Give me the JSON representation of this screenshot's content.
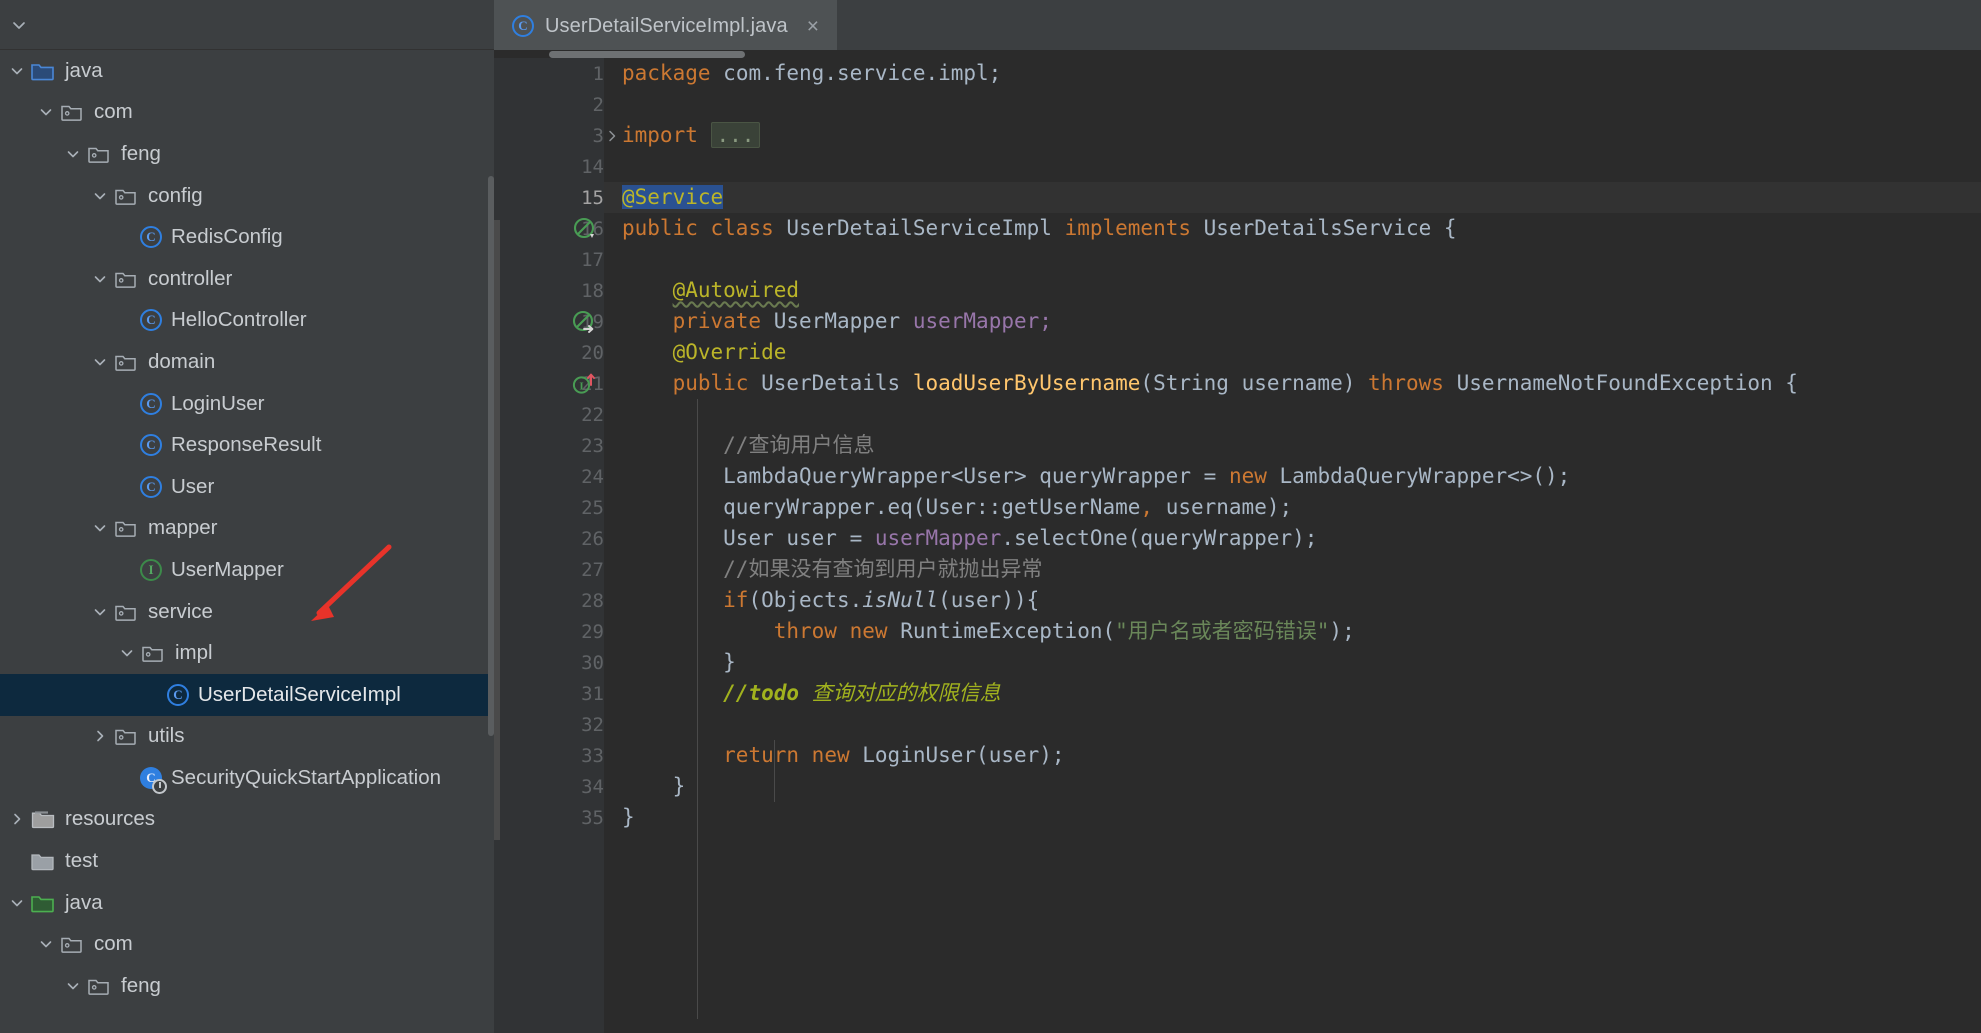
{
  "window": {
    "theme": "darcula",
    "accent_selection": "#2a5191",
    "tree_selection_bg": "#0d293e",
    "editor_bg": "#2b2b2b",
    "gutter_bg": "#313335",
    "panel_bg": "#3c3f41"
  },
  "tabs": {
    "active_index": 0,
    "items": [
      {
        "label": "UserDetailServiceImpl.java",
        "icon": "class-icon",
        "close_label": "×"
      }
    ]
  },
  "project_tree": {
    "collapse_all_icon": "chevron-down-icon",
    "nodes": [
      {
        "label": "java",
        "icon": "folder-source-icon",
        "arrow": "chevron-down",
        "depth": 0,
        "selected": false
      },
      {
        "label": "com",
        "icon": "package-icon",
        "arrow": "chevron-down",
        "depth": 1,
        "selected": false
      },
      {
        "label": "feng",
        "icon": "package-icon",
        "arrow": "chevron-down",
        "depth": 2,
        "selected": false
      },
      {
        "label": "config",
        "icon": "package-icon",
        "arrow": "chevron-down",
        "depth": 3,
        "selected": false
      },
      {
        "label": "RedisConfig",
        "icon": "class-icon",
        "arrow": "none",
        "depth": 4,
        "selected": false
      },
      {
        "label": "controller",
        "icon": "package-icon",
        "arrow": "chevron-down",
        "depth": 3,
        "selected": false
      },
      {
        "label": "HelloController",
        "icon": "class-icon",
        "arrow": "none",
        "depth": 4,
        "selected": false
      },
      {
        "label": "domain",
        "icon": "package-icon",
        "arrow": "chevron-down",
        "depth": 3,
        "selected": false
      },
      {
        "label": "LoginUser",
        "icon": "class-icon",
        "arrow": "none",
        "depth": 4,
        "selected": false
      },
      {
        "label": "ResponseResult",
        "icon": "class-icon",
        "arrow": "none",
        "depth": 4,
        "selected": false
      },
      {
        "label": "User",
        "icon": "class-icon",
        "arrow": "none",
        "depth": 4,
        "selected": false
      },
      {
        "label": "mapper",
        "icon": "package-icon",
        "arrow": "chevron-down",
        "depth": 3,
        "selected": false
      },
      {
        "label": "UserMapper",
        "icon": "interface-icon",
        "arrow": "none",
        "depth": 4,
        "selected": false
      },
      {
        "label": "service",
        "icon": "package-icon",
        "arrow": "chevron-down",
        "depth": 3,
        "selected": false
      },
      {
        "label": "impl",
        "icon": "package-icon",
        "arrow": "chevron-down",
        "depth": 4,
        "selected": false
      },
      {
        "label": "UserDetailServiceImpl",
        "icon": "class-icon",
        "arrow": "none",
        "depth": 5,
        "selected": true
      },
      {
        "label": "utils",
        "icon": "package-icon",
        "arrow": "chevron-right",
        "depth": 3,
        "selected": false
      },
      {
        "label": "SecurityQuickStartApplication",
        "icon": "spring-boot-class-icon",
        "arrow": "none",
        "depth": 3,
        "selected": false
      },
      {
        "label": "resources",
        "icon": "folder-resources-icon",
        "arrow": "chevron-right",
        "depth": 0,
        "selected": false
      },
      {
        "label": "test",
        "icon": "folder-icon",
        "arrow": "none",
        "depth": -1,
        "selected": false
      },
      {
        "label": "java",
        "icon": "folder-source-icon",
        "arrow": "chevron-down",
        "depth": 0,
        "selected": false
      },
      {
        "label": "com",
        "icon": "package-icon",
        "arrow": "chevron-down",
        "depth": 1,
        "selected": false
      },
      {
        "label": "feng",
        "icon": "package-icon",
        "arrow": "chevron-down",
        "depth": 2,
        "selected": false
      }
    ]
  },
  "editor": {
    "filename": "UserDetailServiceImpl.java",
    "current_line": 15,
    "lines": [
      {
        "num": "1",
        "gutter_icon": "none",
        "fold": "none"
      },
      {
        "num": "2",
        "gutter_icon": "none",
        "fold": "none"
      },
      {
        "num": "3",
        "gutter_icon": "none",
        "fold": "chevron-right"
      },
      {
        "num": "14",
        "gutter_icon": "none",
        "fold": "none"
      },
      {
        "num": "15",
        "gutter_icon": "none",
        "fold": "none"
      },
      {
        "num": "16",
        "gutter_icon": "spring-bean",
        "fold": "none"
      },
      {
        "num": "17",
        "gutter_icon": "none",
        "fold": "none"
      },
      {
        "num": "18",
        "gutter_icon": "none",
        "fold": "none"
      },
      {
        "num": "19",
        "gutter_icon": "spring-autowire",
        "fold": "none"
      },
      {
        "num": "20",
        "gutter_icon": "none",
        "fold": "none"
      },
      {
        "num": "21",
        "gutter_icon": "implementing-method",
        "fold": "none"
      },
      {
        "num": "22",
        "gutter_icon": "none",
        "fold": "none"
      },
      {
        "num": "23",
        "gutter_icon": "none",
        "fold": "none"
      },
      {
        "num": "24",
        "gutter_icon": "none",
        "fold": "none"
      },
      {
        "num": "25",
        "gutter_icon": "none",
        "fold": "none"
      },
      {
        "num": "26",
        "gutter_icon": "none",
        "fold": "none"
      },
      {
        "num": "27",
        "gutter_icon": "none",
        "fold": "none"
      },
      {
        "num": "28",
        "gutter_icon": "none",
        "fold": "none"
      },
      {
        "num": "29",
        "gutter_icon": "none",
        "fold": "none"
      },
      {
        "num": "30",
        "gutter_icon": "none",
        "fold": "none"
      },
      {
        "num": "31",
        "gutter_icon": "none",
        "fold": "none"
      },
      {
        "num": "32",
        "gutter_icon": "none",
        "fold": "none"
      },
      {
        "num": "33",
        "gutter_icon": "none",
        "fold": "none"
      },
      {
        "num": "34",
        "gutter_icon": "none",
        "fold": "none"
      },
      {
        "num": "35",
        "gutter_icon": "none",
        "fold": "none"
      }
    ],
    "source_text": {
      "l1": "package com.feng.service.impl;",
      "l3": "import ...",
      "l15": "@Service",
      "l16": "public class UserDetailServiceImpl implements UserDetailsService {",
      "l18": "@Autowired",
      "l19": "private UserMapper userMapper;",
      "l20": "@Override",
      "l21": "public UserDetails loadUserByUsername(String username) throws UsernameNotFoundException {",
      "l23": "//查询用户信息",
      "l24": "LambdaQueryWrapper<User> queryWrapper = new LambdaQueryWrapper<>();",
      "l25": "queryWrapper.eq(User::getUserName, username);",
      "l26": "User user = userMapper.selectOne(queryWrapper);",
      "l27": "//如果没有查询到用户就抛出异常",
      "l28": "if(Objects.isNull(user)){",
      "l29": "throw new RuntimeException(\"用户名或者密码错误\");",
      "l30": "}",
      "l31": "//todo 查询对应的权限信息",
      "l33": "return new LoginUser(user);",
      "l34": "}",
      "l35": "}"
    },
    "tokens": {
      "kw_package": "package",
      "pkg_name": "com.feng.service.impl;",
      "kw_import": "import",
      "fold_placeholder": "...",
      "ann_service": "@Service",
      "kw_public": "public",
      "kw_class": "class",
      "type_impl": "UserDetailServiceImpl",
      "kw_implements": "implements",
      "type_userdetailsservice": "UserDetailsService",
      "brace_open": "{",
      "ann_autowired": "@Autowired",
      "kw_private": "private",
      "type_usermapper": "UserMapper",
      "field_usermapper": "userMapper;",
      "ann_override": "@Override",
      "type_userdetails": "UserDetails",
      "mth_load": "loadUserByUsername",
      "param_string": "String",
      "param_username": "username",
      "kw_throws": "throws",
      "type_unfe": "UsernameNotFoundException",
      "cmt_query_user": "//查询用户信息",
      "type_lqw": "LambdaQueryWrapper<User>",
      "var_querywrapper": "queryWrapper",
      "kw_new": "new",
      "new_lqw": "LambdaQueryWrapper<>();",
      "eq_call": "queryWrapper.eq(User::getUserName",
      "eq_arg": " username);",
      "user_decl": "User user = ",
      "field_um": "userMapper",
      "select_call": ".selectOne(queryWrapper);",
      "cmt_throw": "//如果没有查询到用户就抛出异常",
      "kw_if": "if",
      "objects_is": "(Objects.",
      "mth_isnull": "isNull",
      "isnull_tail": "(user)){",
      "kw_throw": "throw",
      "type_rte": "RuntimeException(",
      "str_err": "\"用户名或者密码错误\"",
      "rte_tail": ");",
      "brace_close": "}",
      "todo_kw": "//todo",
      "todo_text": "查询对应的权限信息",
      "kw_return": "return",
      "new_loginuser": "LoginUser(user);"
    }
  },
  "annotation": {
    "type": "red-arrow-pointer",
    "color": "#e8332a",
    "points_to": "UserDetailServiceImpl"
  }
}
